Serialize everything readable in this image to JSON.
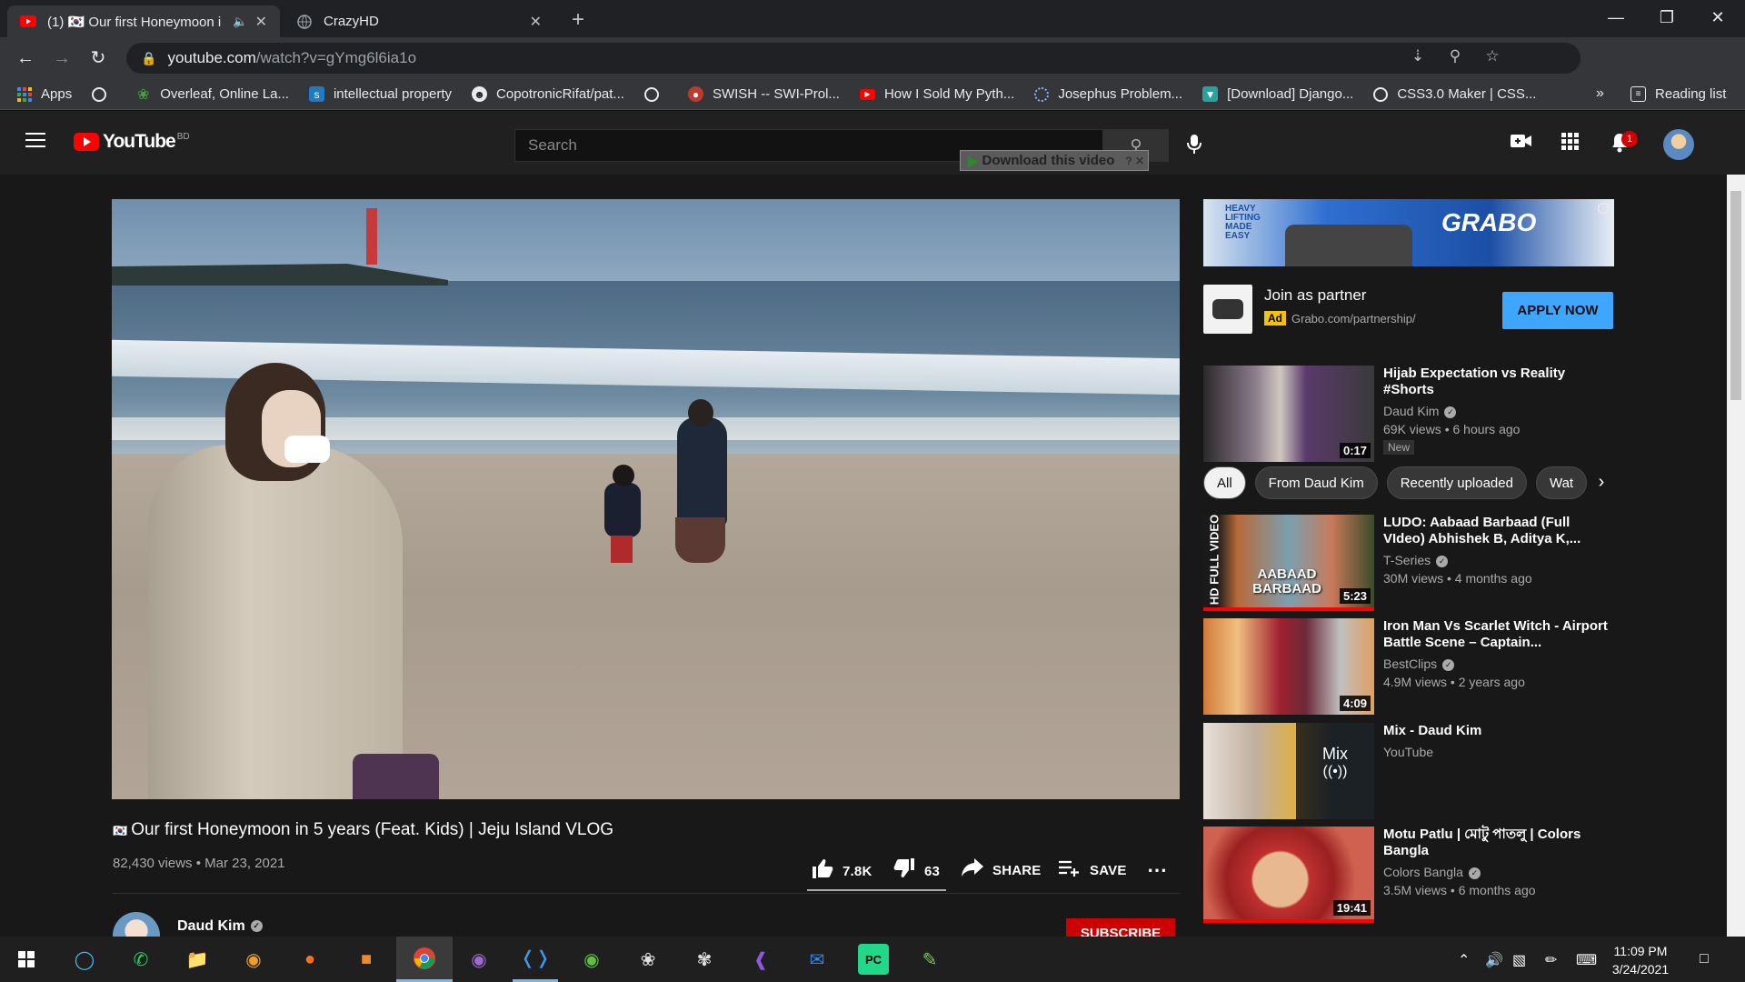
{
  "browser": {
    "tabs": [
      {
        "label": "(1) 🇰🇷 Our first Honeymoon i",
        "favicon": "youtube-icon",
        "muted_icon": "speaker-muted-icon"
      },
      {
        "label": "CrazyHD",
        "favicon": "globe-icon"
      }
    ],
    "url_host": "youtube.com",
    "url_path": "/watch?v=gYmg6l6ia1o",
    "bookmarks": [
      {
        "label": "Apps",
        "icon": "apps-grid-icon"
      },
      {
        "label": "",
        "icon": "globe-icon"
      },
      {
        "label": "Overleaf, Online La...",
        "icon": "overleaf-icon"
      },
      {
        "label": "intellectual property",
        "icon": "scribd-icon"
      },
      {
        "label": "CopotronicRifat/pat...",
        "icon": "github-icon"
      },
      {
        "label": "",
        "icon": "globe-icon"
      },
      {
        "label": "SWISH -- SWI-Prol...",
        "icon": "swipl-icon"
      },
      {
        "label": "How I Sold My Pyth...",
        "icon": "youtube-icon"
      },
      {
        "label": "Josephus Problem...",
        "icon": "loading-icon"
      },
      {
        "label": "[Download] Django...",
        "icon": "download-site-icon"
      },
      {
        "label": "CSS3.0 Maker | CSS...",
        "icon": "globe-icon"
      }
    ],
    "reading_list": "Reading list",
    "more": "»"
  },
  "youtube": {
    "region": "BD",
    "search_placeholder": "Search",
    "download_helper": "Download this video",
    "notification_count": "1"
  },
  "video": {
    "flag": "🇰🇷",
    "title": "Our first Honeymoon in 5 years (Feat. Kids) | Jeju Island VLOG",
    "meta": "82,430 views • Mar 23, 2021",
    "likes": "7.8K",
    "dislikes": "63",
    "like_ratio": 0.99,
    "share": "SHARE",
    "save": "SAVE",
    "channel": "Daud Kim",
    "subscribe": "SUBSCRIBE"
  },
  "ad": {
    "brand": "GRABO",
    "tagline": "HEAVY LIFTING MADE EASY",
    "title": "Join as partner",
    "badge": "Ad",
    "url": "Grabo.com/partnership/",
    "cta": "APPLY NOW"
  },
  "chips": [
    "All",
    "From Daud Kim",
    "Recently uploaded",
    "Wat"
  ],
  "recommendations": [
    {
      "title": "Hijab Expectation vs Reality #Shorts",
      "channel": "Daud Kim",
      "verified": true,
      "views": "69K views • 6 hours ago",
      "duration": "0:17",
      "badge": "New"
    },
    {
      "title": "LUDO: Aabaad Barbaad (Full VIdeo) Abhishek B, Aditya K,...",
      "channel": "T-Series",
      "verified": true,
      "views": "30M views • 4 months ago",
      "duration": "5:23",
      "thumb_text": "AABAAD BARBAAD",
      "side_text": "HD FULL VIDEO"
    },
    {
      "title": "Iron Man Vs Scarlet Witch - Airport Battle Scene – Captain...",
      "channel": "BestClips",
      "verified": true,
      "views": "4.9M views • 2 years ago",
      "duration": "4:09"
    },
    {
      "title": "Mix - Daud Kim",
      "channel": "YouTube",
      "verified": false,
      "views": "",
      "duration": "",
      "mix_label": "Mix"
    },
    {
      "title": "Motu Patlu | মোটু পাতলু | Colors Bangla",
      "channel": "Colors Bangla",
      "verified": true,
      "views": "3.5M views • 6 months ago",
      "duration": "19:41"
    }
  ],
  "taskbar": {
    "time": "11:09 PM",
    "date": "3/24/2021"
  }
}
